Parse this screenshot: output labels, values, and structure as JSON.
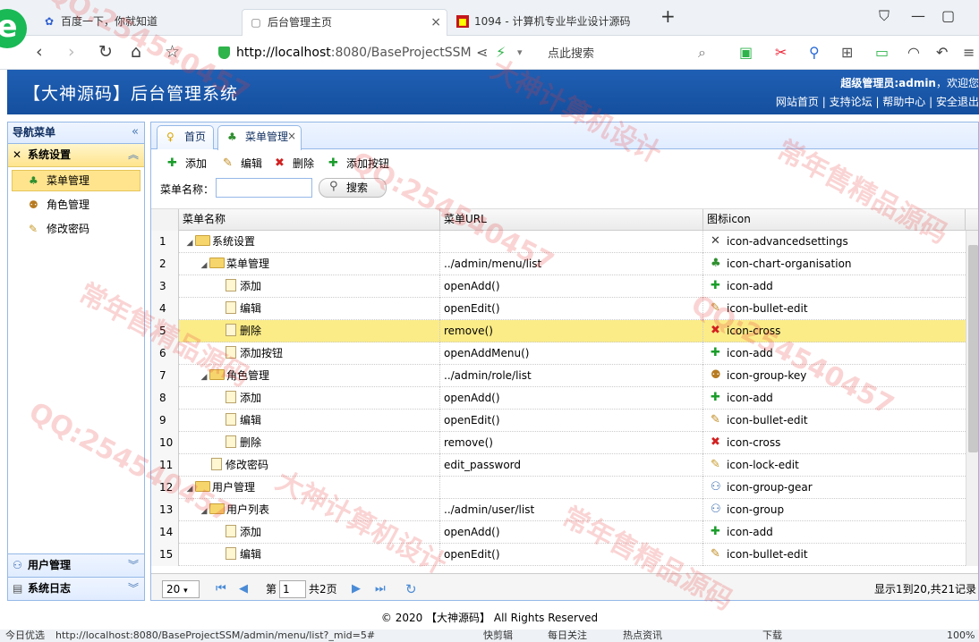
{
  "browser": {
    "tabs": [
      {
        "title": "百度一下，你就知道"
      },
      {
        "title": "后台管理主页"
      },
      {
        "title": "1094 - 计算机专业毕业设计源码"
      }
    ],
    "new_tab": "+",
    "url_host": "http://localhost",
    "url_rest": ":8080/BaseProjectSSM",
    "search_placeholder": "点此搜索",
    "status_url": "http://localhost:8080/BaseProjectSSM/admin/menu/list?_mid=5#",
    "status_left": "今日优选",
    "status_items": [
      "快剪辑",
      "每日关注",
      "热点资讯",
      "下载",
      "100%"
    ]
  },
  "app": {
    "title": "【大神源码】后台管理系统",
    "user_label": "超级管理员:admin",
    "welcome": "，欢迎您",
    "links": [
      "网站首页",
      "支持论坛",
      "帮助中心",
      "安全退出"
    ],
    "footer": "© 2020 【大神源码】 All Rights Reserved"
  },
  "sidebar": {
    "title": "导航菜单",
    "collapse": "«",
    "groups": [
      {
        "label": "系统设置",
        "items": [
          {
            "label": "菜单管理"
          },
          {
            "label": "角色管理"
          },
          {
            "label": "修改密码"
          }
        ]
      },
      {
        "label": "用户管理"
      },
      {
        "label": "系统日志"
      }
    ]
  },
  "main": {
    "tabs": [
      {
        "label": "首页"
      },
      {
        "label": "菜单管理"
      }
    ],
    "toolbar": {
      "add": "添加",
      "edit": "编辑",
      "remove": "删除",
      "add_button": "添加按钮"
    },
    "search": {
      "label": "菜单名称：",
      "value": "",
      "button": "搜索"
    },
    "columns": [
      "菜单名称",
      "菜单URL",
      "图标icon"
    ],
    "rows": [
      {
        "n": "1",
        "name": "系统设置",
        "url": "",
        "icon": "icon-advancedsettings"
      },
      {
        "n": "2",
        "name": "菜单管理",
        "url": "../admin/menu/list",
        "icon": "icon-chart-organisation"
      },
      {
        "n": "3",
        "name": "添加",
        "url": "openAdd()",
        "icon": "icon-add"
      },
      {
        "n": "4",
        "name": "编辑",
        "url": "openEdit()",
        "icon": "icon-bullet-edit"
      },
      {
        "n": "5",
        "name": "删除",
        "url": "remove()",
        "icon": "icon-cross"
      },
      {
        "n": "6",
        "name": "添加按钮",
        "url": "openAddMenu()",
        "icon": "icon-add"
      },
      {
        "n": "7",
        "name": "角色管理",
        "url": "../admin/role/list",
        "icon": "icon-group-key"
      },
      {
        "n": "8",
        "name": "添加",
        "url": "openAdd()",
        "icon": "icon-add"
      },
      {
        "n": "9",
        "name": "编辑",
        "url": "openEdit()",
        "icon": "icon-bullet-edit"
      },
      {
        "n": "10",
        "name": "删除",
        "url": "remove()",
        "icon": "icon-cross"
      },
      {
        "n": "11",
        "name": "修改密码",
        "url": "edit_password",
        "icon": "icon-lock-edit"
      },
      {
        "n": "12",
        "name": "用户管理",
        "url": "",
        "icon": "icon-group-gear"
      },
      {
        "n": "13",
        "name": "用户列表",
        "url": "../admin/user/list",
        "icon": "icon-group"
      },
      {
        "n": "14",
        "name": "添加",
        "url": "openAdd()",
        "icon": "icon-add"
      },
      {
        "n": "15",
        "name": "编辑",
        "url": "openEdit()",
        "icon": "icon-bullet-edit"
      }
    ],
    "pager": {
      "page_size": "20",
      "page_label": "第",
      "page": "1",
      "total_pages": "共2页",
      "info": "显示1到20,共21记录"
    }
  },
  "watermarks": [
    "QQ:254540457",
    "大神计算机设计",
    "常年售精品源码"
  ]
}
